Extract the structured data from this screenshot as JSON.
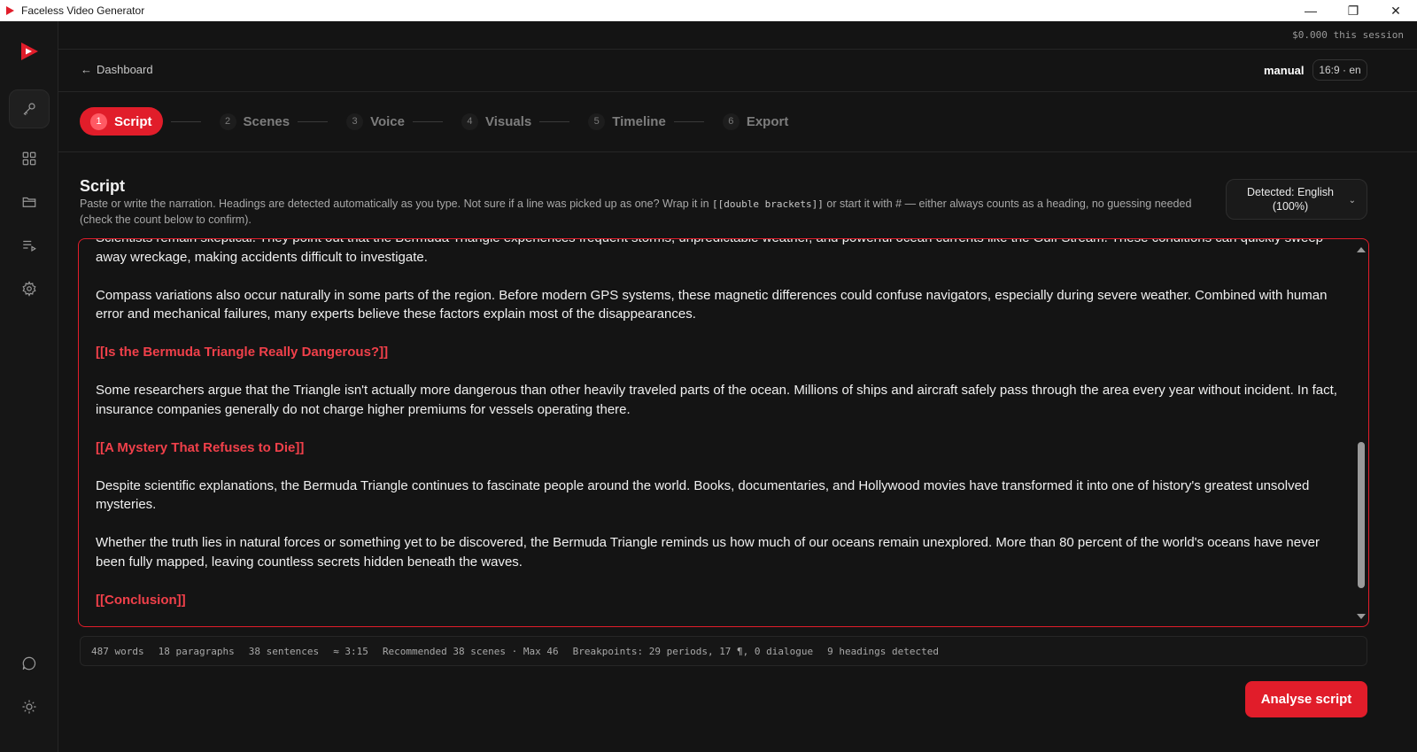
{
  "window": {
    "title": "Faceless Video Generator",
    "controls": [
      "—",
      "❐",
      "✕"
    ]
  },
  "topbar": {
    "cost": "$0.000 this session",
    "back_label": "Dashboard",
    "mode": "manual",
    "aspect_lang": "16:9 · en"
  },
  "rail": {
    "items": [
      "key-icon",
      "grid-icon",
      "folder-icon",
      "playlist-icon",
      "settings-icon",
      "chat-icon",
      "theme-icon"
    ]
  },
  "stepper": {
    "steps": [
      {
        "num": "1",
        "label": "Script"
      },
      {
        "num": "2",
        "label": "Scenes"
      },
      {
        "num": "3",
        "label": "Voice"
      },
      {
        "num": "4",
        "label": "Visuals"
      },
      {
        "num": "5",
        "label": "Timeline"
      },
      {
        "num": "6",
        "label": "Export"
      }
    ]
  },
  "script": {
    "heading": "Script",
    "desc_part1": "Paste or write the narration. Headings are detected automatically as you type. Not sure if a line was picked up as one? Wrap it in ",
    "desc_code": "[[double brackets]]",
    "desc_part2": " or start it with # — either always counts as a heading, no guessing needed (check the count below to confirm).",
    "language_line1": "Detected: English",
    "language_line2": "(100%)"
  },
  "editor": {
    "paragraphs": [
      {
        "text": "Scientists remain skeptical. They point out that the Bermuda Triangle experiences frequent storms, unpredictable weather, and powerful ocean currents like the Gulf Stream. These conditions can quickly sweep away wreckage, making accidents difficult to investigate.",
        "heading": false
      },
      {
        "text": "Compass variations also occur naturally in some parts of the region. Before modern GPS systems, these magnetic differences could confuse navigators, especially during severe weather. Combined with human error and mechanical failures, many experts believe these factors explain most of the disappearances.",
        "heading": false
      },
      {
        "text": "[[Is the Bermuda Triangle Really Dangerous?]]",
        "heading": true
      },
      {
        "text": "Some researchers argue that the Triangle isn't actually more dangerous than other heavily traveled parts of the ocean. Millions of ships and aircraft safely pass through the area every year without incident. In fact, insurance companies generally do not charge higher premiums for vessels operating there.",
        "heading": false
      },
      {
        "text": "[[A Mystery That Refuses to Die]]",
        "heading": true
      },
      {
        "text": "Despite scientific explanations, the Bermuda Triangle continues to fascinate people around the world. Books, documentaries, and Hollywood movies have transformed it into one of history's greatest unsolved mysteries.",
        "heading": false
      },
      {
        "text": "Whether the truth lies in natural forces or something yet to be discovered, the Bermuda Triangle reminds us how much of our oceans remain unexplored. More than 80 percent of the world's oceans have never been fully mapped, leaving countless secrets hidden beneath the waves.",
        "heading": false
      },
      {
        "text": "[[Conclusion]]",
        "heading": true
      }
    ],
    "scroll_position": 0.62
  },
  "stats": {
    "words": "487 words",
    "paragraphs": "18 paragraphs",
    "sentences": "38 sentences",
    "duration": "≈ 3:15",
    "recommended": "Recommended 38 scenes · Max 46",
    "breakpoints": "Breakpoints: 29 periods, 17 ¶, 0 dialogue",
    "headings": "9 headings detected"
  },
  "actions": {
    "analyse_label": "Analyse script"
  },
  "colors": {
    "accent": "#e11d2a",
    "heading_text": "#f0404a",
    "background": "#141414"
  }
}
